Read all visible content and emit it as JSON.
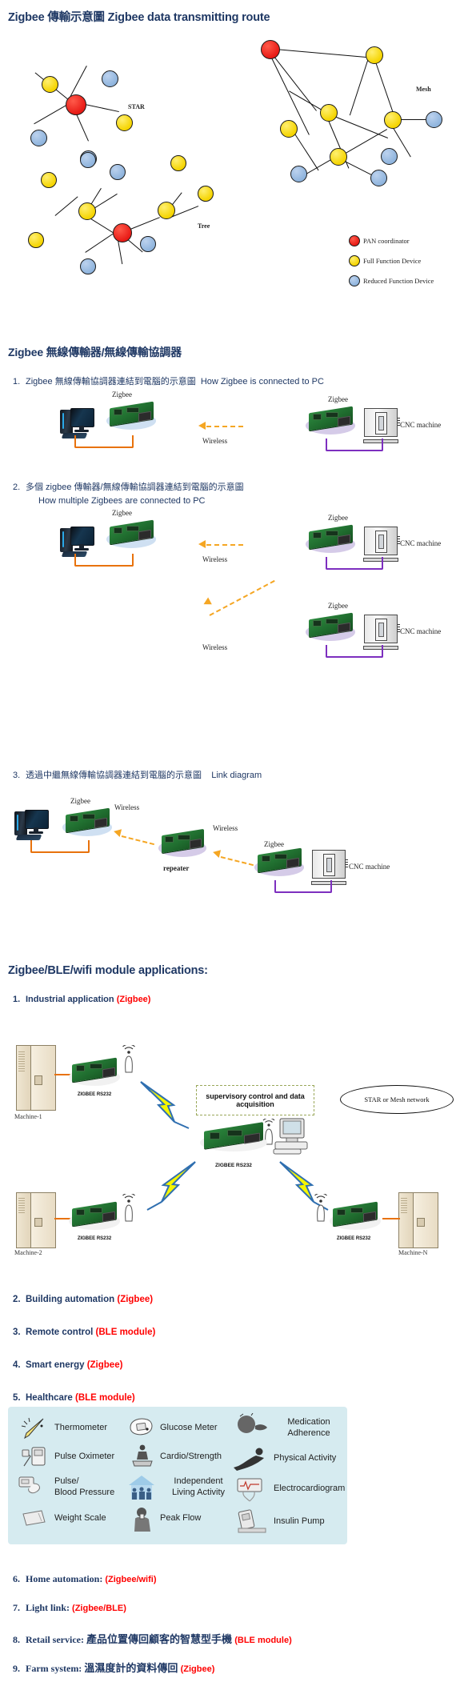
{
  "section1": {
    "title": "Zigbee 傳輸示意圖  Zigbee data transmitting route",
    "topology_labels": {
      "star": "STAR",
      "mesh": "Mesh",
      "tree": "Tree"
    },
    "legend": [
      {
        "color": "#e81b16",
        "label": "PAN coordinator"
      },
      {
        "color": "#f5d400",
        "label": "Full Function Device"
      },
      {
        "color": "#8fb4dd",
        "label": "Reduced Function Device"
      }
    ]
  },
  "section2": {
    "title": "Zigbee  無線傳輸器/無線傳輸協調器",
    "items": [
      {
        "idx": "1.",
        "zh": "Zigbee 無線傳輸協調器連結到電腦的示意圖",
        "en": "How Zigbee is connected to PC"
      },
      {
        "idx": "2.",
        "zh": "多個 zigbee 傳輸器/無線傳輸協調器連結到電腦的示意圖",
        "en": "How multiple Zigbees are connected to PC"
      },
      {
        "idx": "3.",
        "zh": "透過中繼無線傳輸協調器連結到電腦的示意圖",
        "en": "Link diagram"
      }
    ],
    "diagram_labels": {
      "zigbee": "Zigbee",
      "wireless": "Wireless",
      "cnc": "CNC machine",
      "repeater": "repeater"
    }
  },
  "section3": {
    "title": "Zigbee/BLE/wifi module applications:",
    "items": [
      {
        "idx": "1.",
        "label": "Industrial application ",
        "tag": "(Zigbee)"
      },
      {
        "idx": "2.",
        "label": "Building automation ",
        "tag": "(Zigbee)"
      },
      {
        "idx": "3.",
        "label": "Remote control ",
        "tag": "(BLE module)"
      },
      {
        "idx": "4.",
        "label": "Smart energy    ",
        "tag": "(Zigbee)"
      },
      {
        "idx": "5.",
        "label": "Healthcare    ",
        "tag": "(BLE module)"
      }
    ],
    "items_serif": [
      {
        "idx": "6.",
        "label": "Home automation: ",
        "tag": "(Zigbee/wifi)",
        "zh": ""
      },
      {
        "idx": "7.",
        "label": "Light link: ",
        "tag": "(Zigbee/BLE)",
        "zh": ""
      },
      {
        "idx": "8.",
        "label": "Retail service:  ",
        "zh": "產品位置傳回顧客的智慧型手機 ",
        "tag": "(BLE module)"
      },
      {
        "idx": "9.",
        "label": "Farm system:  ",
        "zh": "溫濕度計的資料傳回 ",
        "tag": "(Zigbee)"
      }
    ],
    "industrial": {
      "scada_text": "supervisory control and data acquisition",
      "network_tag": "STAR or Mesh network",
      "module_tag": "ZIGBEE RS232",
      "machines": [
        "Machine-1",
        "Machine-2",
        "Machine-N"
      ]
    },
    "healthcare_panel": {
      "col1": [
        {
          "icon": "thermometer-icon",
          "label": "Thermometer"
        },
        {
          "icon": "pulse-oximeter-icon",
          "label": "Pulse Oximeter"
        },
        {
          "icon": "blood-pressure-icon",
          "label": "Pulse/\nBlood Pressure"
        },
        {
          "icon": "weight-scale-icon",
          "label": "Weight Scale"
        }
      ],
      "col2": [
        {
          "icon": "glucose-meter-icon",
          "label": "Glucose Meter"
        },
        {
          "icon": "cardio-strength-icon",
          "label": "Cardio/Strength"
        },
        {
          "icon": "independent-living-icon",
          "label": "Independent\nLiving Activity"
        },
        {
          "icon": "peak-flow-icon",
          "label": "Peak Flow"
        }
      ],
      "col3": [
        {
          "icon": "medication-adherence-icon",
          "label": "Medication\nAdherence"
        },
        {
          "icon": "physical-activity-icon",
          "label": "Physical Activity"
        },
        {
          "icon": "electrocardiogram-icon",
          "label": "Electrocardiogram"
        },
        {
          "icon": "insulin-pump-icon",
          "label": "Insulin Pump"
        }
      ]
    }
  },
  "colors": {
    "heading": "#1F3864",
    "accent_red": "#FF0000",
    "wire_orange": "#E8720C",
    "wire_purple": "#7D2FBF",
    "dash_yellow": "#F5A623",
    "panel_bg": "#D6EBF0"
  }
}
